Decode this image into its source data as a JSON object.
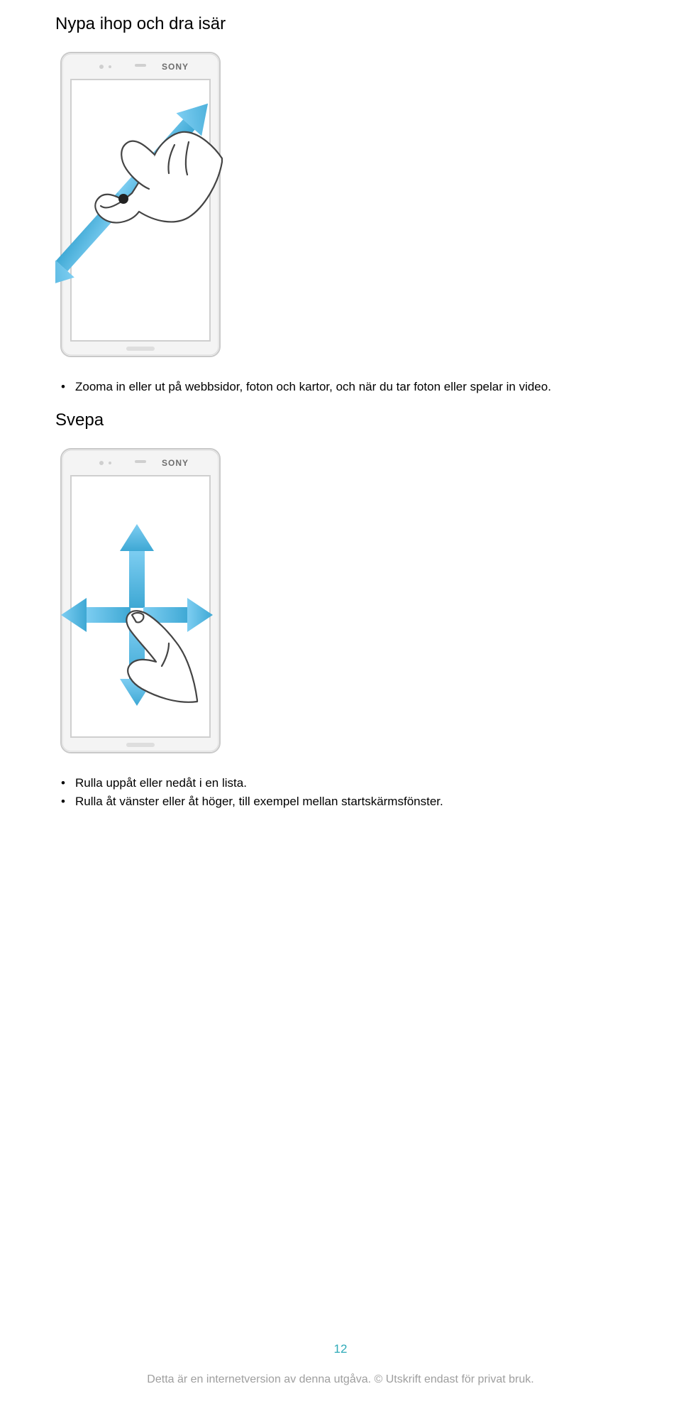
{
  "section1": {
    "heading": "Nypa ihop och dra isär",
    "bullet": "Zooma in eller ut på webbsidor, foton och kartor, och när du tar foton eller spelar in video."
  },
  "section2": {
    "heading": "Svepa",
    "bullet_a": "Rulla uppåt eller nedåt i en lista.",
    "bullet_b": "Rulla åt vänster eller åt höger, till exempel mellan startskärmsfönster."
  },
  "page_number": "12",
  "footer": "Detta är en internetversion av denna utgåva. © Utskrift endast för privat bruk."
}
